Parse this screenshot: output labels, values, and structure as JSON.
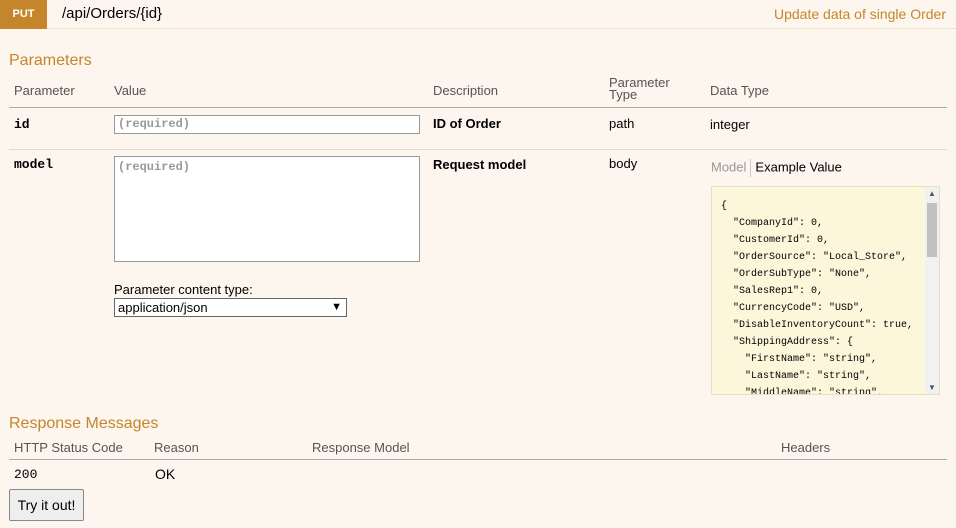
{
  "header": {
    "method": "PUT",
    "path": "/api/Orders/{id}",
    "summary": "Update data of single Order"
  },
  "parameters": {
    "title": "Parameters",
    "columns": {
      "parameter": "Parameter",
      "value": "Value",
      "description": "Description",
      "parameter_type_line1": "Parameter",
      "parameter_type_line2": "Type",
      "data_type": "Data Type"
    },
    "rows": [
      {
        "name": "id",
        "placeholder": "(required)",
        "description": "ID of Order",
        "param_type": "path",
        "data_type": "integer"
      },
      {
        "name": "model",
        "placeholder": "(required)",
        "description": "Request model",
        "param_type": "body",
        "content_type_label": "Parameter content type:",
        "content_type_value": "application/json",
        "model_tab": "Model",
        "example_tab": "Example Value",
        "example_lines": [
          "{",
          "  \"CompanyId\": 0,",
          "  \"CustomerId\": 0,",
          "  \"OrderSource\": \"Local_Store\",",
          "  \"OrderSubType\": \"None\",",
          "  \"SalesRep1\": 0,",
          "  \"CurrencyCode\": \"USD\",",
          "  \"DisableInventoryCount\": true,",
          "  \"ShippingAddress\": {",
          "    \"FirstName\": \"string\",",
          "    \"LastName\": \"string\",",
          "    \"MiddleName\": \"string\","
        ]
      }
    ]
  },
  "responses": {
    "title": "Response Messages",
    "columns": {
      "status": "HTTP Status Code",
      "reason": "Reason",
      "model": "Response Model",
      "headers": "Headers"
    },
    "rows": [
      {
        "status": "200",
        "reason": "OK"
      }
    ]
  },
  "try_button": "Try it out!",
  "colors": {
    "accent": "#c5862b",
    "background": "#fcf6ef",
    "snippet_bg": "#fcf6db"
  }
}
